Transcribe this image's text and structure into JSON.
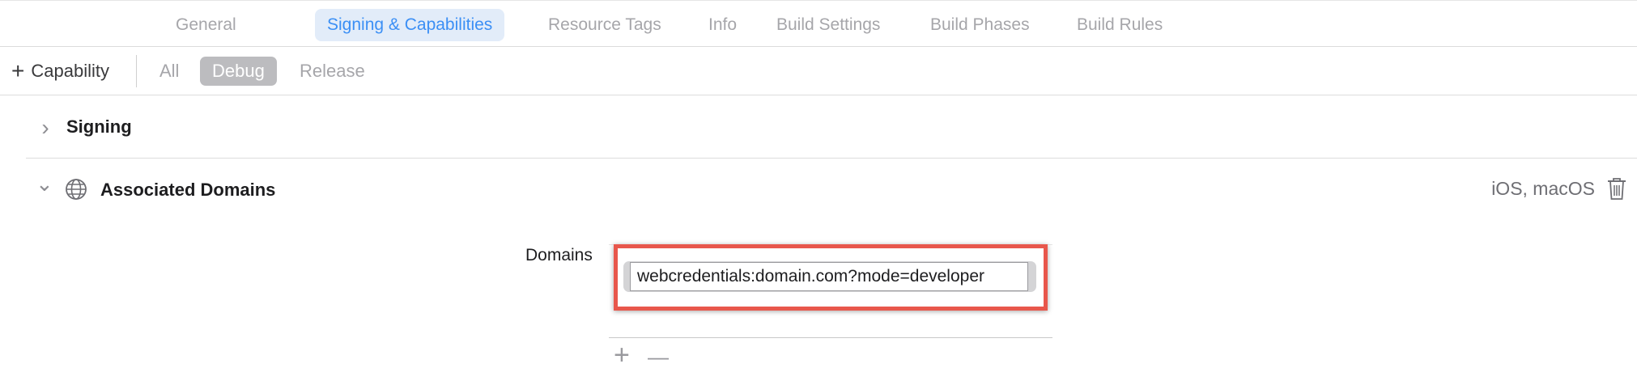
{
  "tabs": [
    {
      "label": "General",
      "active": false
    },
    {
      "label": "Signing & Capabilities",
      "active": true
    },
    {
      "label": "Resource Tags",
      "active": false
    },
    {
      "label": "Info",
      "active": false
    },
    {
      "label": "Build Settings",
      "active": false
    },
    {
      "label": "Build Phases",
      "active": false
    },
    {
      "label": "Build Rules",
      "active": false
    }
  ],
  "toolbar": {
    "capability_plus": "+",
    "capability_label": "Capability",
    "filters": [
      {
        "label": "All",
        "selected": false
      },
      {
        "label": "Debug",
        "selected": true
      },
      {
        "label": "Release",
        "selected": false
      }
    ]
  },
  "signing": {
    "chevron": "›",
    "title": "Signing"
  },
  "associated_domains": {
    "chevron": "⌄",
    "icon": "globe-icon",
    "title": "Associated Domains",
    "platforms": "iOS, macOS",
    "delete_icon": "trash-icon",
    "domains_label": "Domains",
    "domains": [
      "webcredentials:domain.com?mode=developer"
    ],
    "add_symbol": "+",
    "remove_symbol": "—"
  },
  "colors": {
    "accent": "#3b8ff5",
    "highlight_border": "#e8574c",
    "selected_segment": "#bcbcbf"
  }
}
